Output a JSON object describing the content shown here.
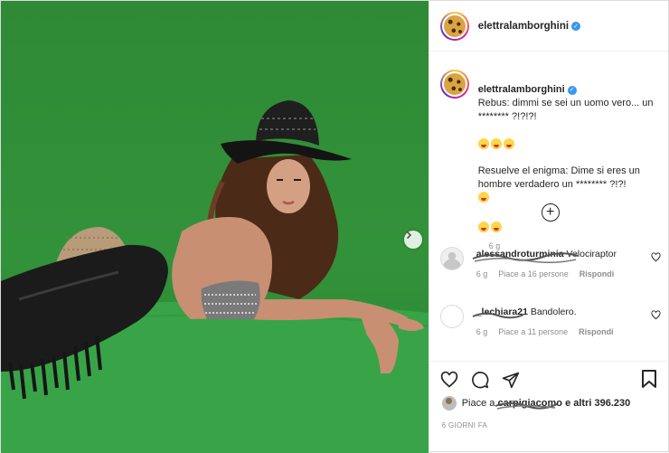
{
  "post": {
    "author": "elettralamborghini",
    "verified_icon": "verified-badge-icon",
    "caption_line1": "Rebus: dimmi se sei un uomo vero... un ******** ?!?!?!",
    "caption_line2": "Resuelve el enigma: Dime si eres un hombre verdadero un ******** ?!?!",
    "caption_age": "6 g",
    "colors": {
      "accent": "#3897f0",
      "text": "#262626",
      "muted": "#8e8e8e",
      "green_screen": "#32923a"
    }
  },
  "comments": [
    {
      "user": "alessandroturminia",
      "text": "Velociraptor",
      "age": "6 g",
      "likes": "Piace a 16 persone",
      "reply": "Rispondi"
    },
    {
      "user": "_lechiara21",
      "text": "Bandolero.",
      "age": "6 g",
      "likes": "Piace a 11 persone",
      "reply": "Rispondi"
    }
  ],
  "likes": {
    "prefix": "Piace a",
    "user": "carpigiacomo",
    "suffix": "e altri 396.230"
  },
  "posted": "6 GIORNI FA"
}
